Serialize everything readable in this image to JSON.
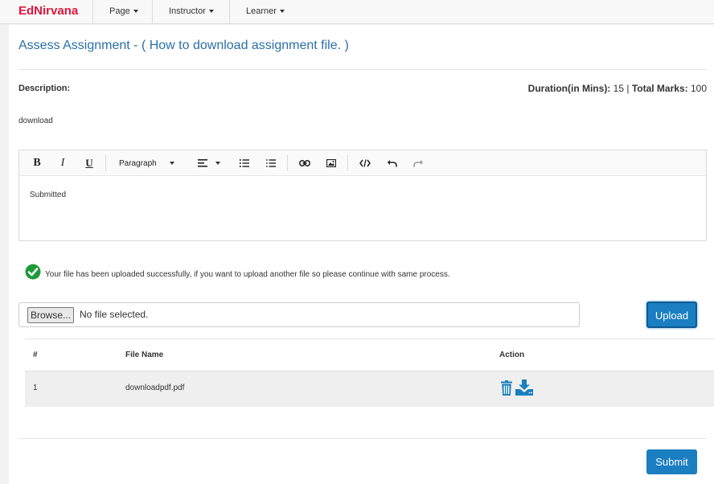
{
  "nav": {
    "brand": "EdNirvana",
    "items": [
      {
        "label": "Page"
      },
      {
        "label": "Instructor"
      },
      {
        "label": "Learner"
      }
    ]
  },
  "page": {
    "title": "Assess Assignment - ( How to download assignment file. )",
    "description_label": "Description:",
    "description_text": "download",
    "duration_label": "Duration(in Mins):",
    "duration_value": "15",
    "separator": "|",
    "total_marks_label": "Total Marks:",
    "total_marks_value": "100"
  },
  "editor": {
    "paragraph_label": "Paragraph",
    "content": "Submitted",
    "toolbar_icons": [
      "bold-icon",
      "italic-icon",
      "underline-icon",
      "paragraph-dropdown",
      "align-icon",
      "ordered-list-icon",
      "unordered-list-icon",
      "link-icon",
      "image-icon",
      "code-icon",
      "undo-icon",
      "redo-icon"
    ]
  },
  "upload": {
    "success_message": "Your file has been uploaded successfully, if you want to upload another file so please continue with same process.",
    "browse_label": "Browse...",
    "no_file_text": "No file selected.",
    "upload_label": "Upload"
  },
  "table": {
    "headers": [
      "#",
      "File Name",
      "Action"
    ],
    "rows": [
      {
        "index": "1",
        "file_name": "downloadpdf.pdf"
      }
    ]
  },
  "footer": {
    "submit_label": "Submit"
  },
  "colors": {
    "brand": "#e0173d",
    "primary": "#1a7ec1",
    "success": "#1f9a3a",
    "title": "#2a6fa8"
  }
}
